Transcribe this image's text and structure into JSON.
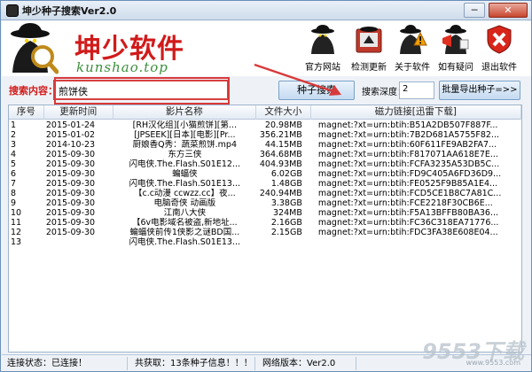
{
  "window": {
    "title": "坤少种子搜索Ver2.0",
    "min": "─",
    "close": "✕"
  },
  "brand": {
    "name": "坤少软件",
    "sub": "kunshao.top"
  },
  "toolbar": [
    {
      "label": "官方网站",
      "icon": "spy-icon"
    },
    {
      "label": "检测更新",
      "icon": "update-icon"
    },
    {
      "label": "关于软件",
      "icon": "about-icon"
    },
    {
      "label": "如有疑问",
      "icon": "question-icon"
    },
    {
      "label": "退出软件",
      "icon": "exit-icon"
    }
  ],
  "search": {
    "label": "搜索内容：",
    "value": "煎饼侠",
    "button": "种子搜索",
    "depth_label": "搜索深度：",
    "depth_value": "2",
    "export_button": "批量导出种子=>>"
  },
  "table": {
    "columns": [
      "序号",
      "更新时间",
      "影片名称",
      "文件大小",
      "磁力链接[迅雷下载]"
    ],
    "rows": [
      [
        "1",
        "2015-01-24",
        "[RH汉化组][小猫煎饼][第...",
        "20.98MB",
        "magnet:?xt=urn:btih:B51A2DB507F887F..."
      ],
      [
        "2",
        "2015-01-02",
        "[JPSEEK][日本][电影][Pr...",
        "356.21MB",
        "magnet:?xt=urn:btih:7B2D681A5755F82..."
      ],
      [
        "3",
        "2014-10-23",
        "厨娘香Q秀：蔬菜煎饼.mp4",
        "44.15MB",
        "magnet:?xt=urn:btih:60F611FE9AB2FA7..."
      ],
      [
        "4",
        "2015-09-30",
        "东方三侠",
        "364.68MB",
        "magnet:?xt=urn:btih:F817071AA618E7E..."
      ],
      [
        "5",
        "2015-09-30",
        "闪电侠.The.Flash.S01E12...",
        "404.93MB",
        "magnet:?xt=urn:btih:FCFA3235A53DB5C..."
      ],
      [
        "6",
        "2015-09-30",
        "蝙蝠侠",
        "6.02GB",
        "magnet:?xt=urn:btih:FD9C405A6FD36D9..."
      ],
      [
        "7",
        "2015-09-30",
        "闪电侠.The.Flash.S01E13...",
        "1.48GB",
        "magnet:?xt=urn:btih:FE0525F9B85A1E4..."
      ],
      [
        "8",
        "2015-09-30",
        "【c.c动漫 ccwzz.cc】夜...",
        "240.94MB",
        "magnet:?xt=urn:btih:FCD5CE1B8C7A81C..."
      ],
      [
        "9",
        "2015-09-30",
        "电脑奇侠 动画版",
        "3.38GB",
        "magnet:?xt=urn:btih:FCE2218F30CB6E..."
      ],
      [
        "10",
        "2015-09-30",
        "江南八大侠",
        "324MB",
        "magnet:?xt=urn:btih:F5A13BFFB80BA36..."
      ],
      [
        "11",
        "2015-09-30",
        "【6v电影域名被盗,新地址...",
        "2.16GB",
        "magnet:?xt=urn:btih:FC36C318EA71776..."
      ],
      [
        "12",
        "2015-09-30",
        "蝙蝠侠前传1侠影之谜BD国...",
        "2.15GB",
        "magnet:?xt=urn:btih:FDC3FA38E608E04..."
      ],
      [
        "13",
        "",
        "闪电侠.The.Flash.S01E13...",
        "",
        ""
      ]
    ]
  },
  "status": {
    "connection": "连接状态：已连接！",
    "total": "共获取：13条种子信息！！！",
    "version": "网络版本：Ver2.0"
  },
  "watermark": {
    "text": "9553下载",
    "sub": "www.9553.com"
  },
  "colors": {
    "brand_red": "#d11a1a",
    "brand_green": "#3c8f3c",
    "highlight_red": "#d83a3a"
  }
}
